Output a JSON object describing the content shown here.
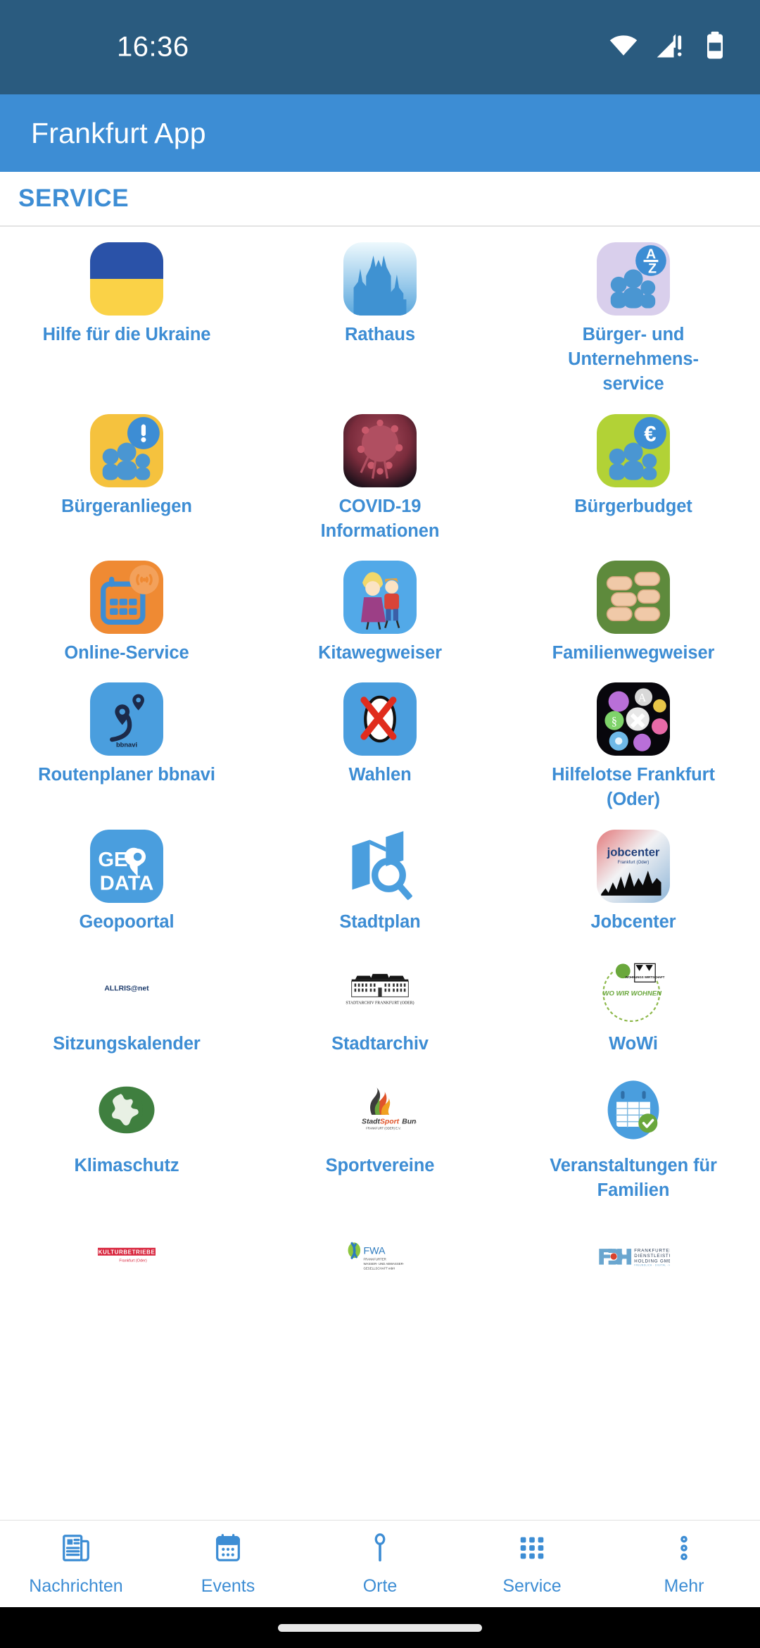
{
  "status_bar": {
    "time": "16:36",
    "icons": [
      "wifi-icon",
      "cellular-no-sim-icon",
      "battery-icon"
    ],
    "background": "#2a5b7f"
  },
  "app_bar": {
    "title": "Frankfurt App",
    "background": "#3d8dd4"
  },
  "section": {
    "title": "SERVICE",
    "accent": "#3d8dd4"
  },
  "grid": {
    "columns": 3,
    "items": [
      {
        "label": "Hilfe für die Ukraine",
        "icon": "ukraine-flag-icon"
      },
      {
        "label": "Rathaus",
        "icon": "town-hall-icon"
      },
      {
        "label": "Bürger- und Unternehmens-service",
        "icon": "a-z-citizens-icon"
      },
      {
        "label": "Bürgeranliegen",
        "icon": "citizens-alert-icon"
      },
      {
        "label": "COVID-19 Informationen",
        "icon": "coronavirus-icon"
      },
      {
        "label": "Bürgerbudget",
        "icon": "citizens-euro-icon"
      },
      {
        "label": "Online-Service",
        "icon": "online-calendar-icon"
      },
      {
        "label": "Kitawegweiser",
        "icon": "children-icon"
      },
      {
        "label": "Familienwegweiser",
        "icon": "joined-hands-icon"
      },
      {
        "label": "Routenplaner bbnavi",
        "icon": "route-planner-icon"
      },
      {
        "label": "Wahlen",
        "icon": "ballot-cross-icon"
      },
      {
        "label": "Hilfelotse Frankfurt (Oder)",
        "icon": "help-bubbles-icon"
      },
      {
        "label": "Geopoortal",
        "icon": "geodata-icon"
      },
      {
        "label": "Stadtplan",
        "icon": "city-map-search-icon"
      },
      {
        "label": "Jobcenter",
        "icon": "jobcenter-logo-icon"
      },
      {
        "label": "Sitzungskalender",
        "icon": "allris-net-logo-icon"
      },
      {
        "label": "Stadtarchiv",
        "icon": "city-archive-building-icon"
      },
      {
        "label": "WoWi",
        "icon": "wowi-logo-icon"
      },
      {
        "label": "Klimaschutz",
        "icon": "globe-leaf-icon"
      },
      {
        "label": "Sportvereine",
        "icon": "stadtsportbund-logo-icon"
      },
      {
        "label": "Veranstaltungen für Familien",
        "icon": "calendar-check-icon"
      },
      {
        "label": "",
        "icon": "kulturbetriebe-logo-icon"
      },
      {
        "label": "",
        "icon": "fwa-logo-icon"
      },
      {
        "label": "",
        "icon": "fdh-logo-icon"
      }
    ],
    "icon_text": {
      "a_z_top": "A",
      "a_z_bottom": "Z",
      "euro_symbol": "€",
      "bbnavi": "bbnavi",
      "geo": "GEO",
      "data": "DATA",
      "jobcenter_main": "jobcenter",
      "jobcenter_sub": "Frankfurt (Oder)",
      "allris": "ALLRIS@net",
      "stadtarchiv_caption": "STADTARCHIV FRANKFURT (ODER)",
      "wowi_brand": "WOHNUNGS WIRTSCHAFT",
      "wowi_script": "WO WIR WOHNEN",
      "ssb_stadt": "Stadt",
      "ssb_sport": "Sport",
      "ssb_bund": "Bund",
      "ssb_sub": "FRANKFURT (ODER) E.V.",
      "kultur_main": "KULTURBETRIEBE",
      "kultur_sub": "Frankfurt (Oder)",
      "fwa_main": "FWA",
      "fwa_l1": "FRANKFURTER",
      "fwa_l2": "WASSER- UND ABWASSER-",
      "fwa_l3": "GESELLSCHAFT mbH",
      "fdh_mark": "FDH",
      "fdh_l1": "FRANKFURTER",
      "fdh_l2": "DIENSTLEISTUNGS",
      "fdh_l3": "HOLDING GMBH",
      "fdh_tag": "FREUNDLICH · DIGITAL · HILFSBEREIT"
    }
  },
  "bottom_nav": {
    "items": [
      {
        "label": "Nachrichten",
        "icon": "newspaper-icon"
      },
      {
        "label": "Events",
        "icon": "calendar-icon"
      },
      {
        "label": "Orte",
        "icon": "map-pin-icon"
      },
      {
        "label": "Service",
        "icon": "grid-icon"
      },
      {
        "label": "Mehr",
        "icon": "more-vertical-icon"
      }
    ],
    "active": "Service",
    "accent": "#3d8dd4"
  }
}
